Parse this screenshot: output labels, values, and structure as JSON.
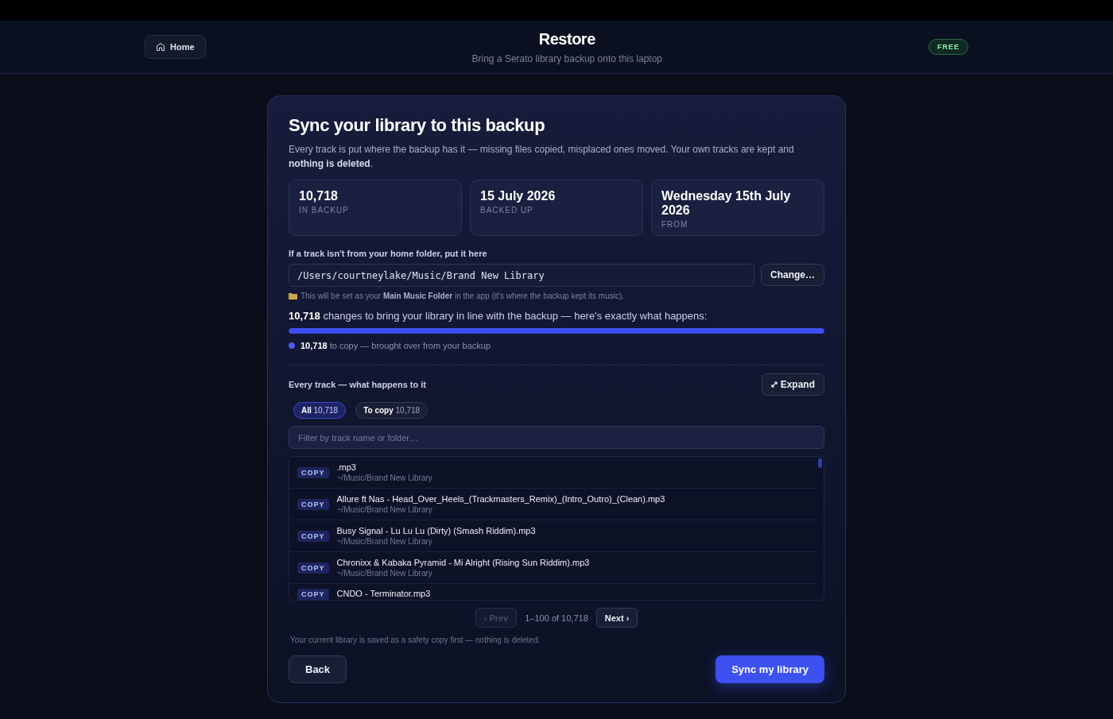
{
  "header": {
    "home_button": "Home",
    "title": "Restore",
    "subtitle": "Bring a Serato library backup onto this laptop",
    "badge": "FREE"
  },
  "card": {
    "title": "Sync your library to this backup",
    "intro": "Every track is put where the backup has it — missing files copied, misplaced ones moved. Your own tracks are kept and **nothing is deleted**.",
    "stats": [
      {
        "value": "10,718",
        "label": "IN BACKUP"
      },
      {
        "value": "15 July 2026",
        "label": "BACKED UP"
      },
      {
        "value": "Wednesday 15th July 2026",
        "label": "FROM"
      }
    ],
    "folder": {
      "label": "If a track isn't from your home folder, put it here",
      "value": "/Users/courtneylake/Music/Brand New Library",
      "button": "Change…",
      "note": "This will be set as your **Main Music Folder** in the app (it's where the backup kept its music)."
    },
    "summary": "**10,718** changes to bring your library in line with the backup — here's exactly what happens:",
    "progress": {
      "level": 1
    },
    "legend": [
      {
        "text": "**10,718** to copy — brought over from your backup",
        "color": "#4a5cf0"
      }
    ],
    "tracks_title": "Every track — what happens to it",
    "expand_button": "Expand",
    "filters": [
      {
        "label": "All",
        "count": "10,718",
        "selected": true
      },
      {
        "label": "To copy",
        "count": "10,718",
        "selected": false
      }
    ],
    "search": {
      "placeholder": "Filter by track name or folder…"
    },
    "tracks": [
      {
        "action": "COPY",
        "name": ".mp3",
        "folder": "~/Music/Brand New Library"
      },
      {
        "action": "COPY",
        "name": "Allure ft Nas - Head_Over_Heels_(Trackmasters_Remix)_(Intro_Outro)_(Clean).mp3",
        "folder": "~/Music/Brand New Library"
      },
      {
        "action": "COPY",
        "name": "Busy Signal - Lu Lu Lu (Dirty) (Smash Riddim).mp3",
        "folder": "~/Music/Brand New Library"
      },
      {
        "action": "COPY",
        "name": "Chronixx & Kabaka Pyramid - Mi Alright (Rising Sun Riddim).mp3",
        "folder": "~/Music/Brand New Library"
      },
      {
        "action": "COPY",
        "name": "CNDO - Terminator.mp3"
      }
    ],
    "pagination": {
      "prev": {
        "label": "‹ Prev",
        "disabled": true
      },
      "range": "1–100 of 10,718",
      "next": {
        "label": "Next ›",
        "disabled": false
      }
    },
    "safety_note": "Your current library is saved as a safety copy first — nothing is deleted.",
    "back_button": "Back",
    "sync_button": "Sync my library"
  }
}
